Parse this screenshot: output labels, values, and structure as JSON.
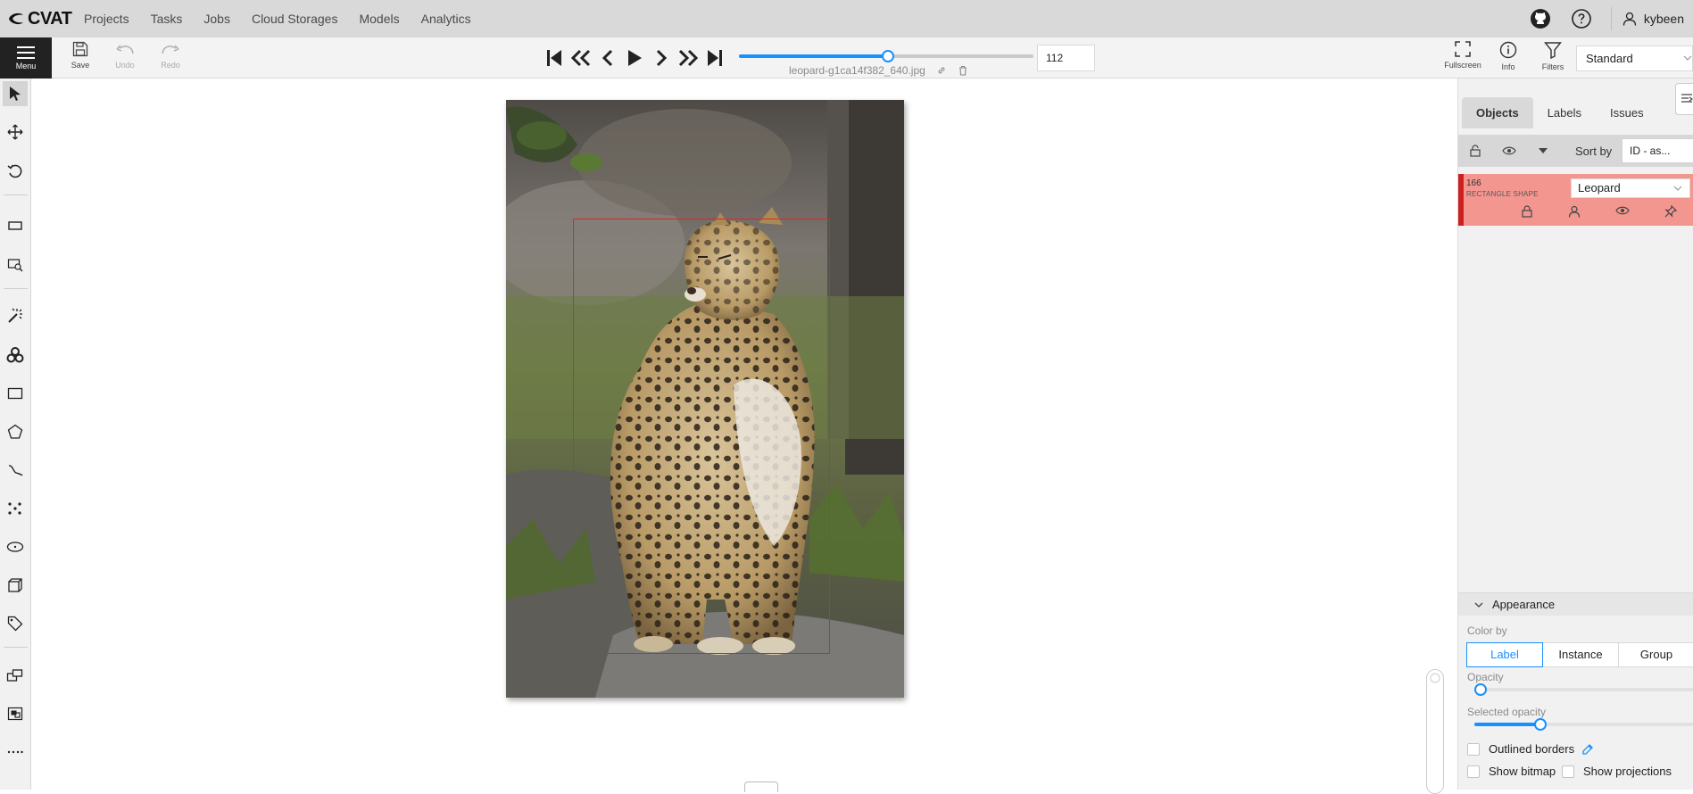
{
  "app": {
    "logo_text": "CVAT"
  },
  "nav": {
    "links": [
      "Projects",
      "Tasks",
      "Jobs",
      "Cloud Storages",
      "Models",
      "Analytics"
    ],
    "user": "kybeen"
  },
  "toolbar": {
    "menu_label": "Menu",
    "save_label": "Save",
    "undo_label": "Undo",
    "redo_label": "Redo",
    "filename": "leopard-g1ca14f382_640.jpg",
    "frame_number": "112",
    "frame_progress": 0.506,
    "fullscreen_label": "Fullscreen",
    "info_label": "Info",
    "filters_label": "Filters",
    "workspace": "Standard"
  },
  "sidebar": {
    "tabs": [
      "Objects",
      "Labels",
      "Issues"
    ],
    "sort_label": "Sort by",
    "sort_value": "ID - as...",
    "object": {
      "id": "166",
      "type": "RECTANGLE SHAPE",
      "label": "Leopard",
      "color": "#f49690"
    }
  },
  "appearance": {
    "title": "Appearance",
    "color_by_label": "Color by",
    "color_by_options": [
      "Label",
      "Instance",
      "Group"
    ],
    "color_by_selected": "Label",
    "opacity_label": "Opacity",
    "opacity_value": 0.03,
    "selected_opacity_label": "Selected opacity",
    "selected_opacity_value": 0.3,
    "outlined_borders_label": "Outlined borders",
    "show_bitmap_label": "Show bitmap",
    "show_projections_label": "Show projections"
  },
  "colors": {
    "accent": "#1890ff",
    "bbox": "#e8202a"
  }
}
